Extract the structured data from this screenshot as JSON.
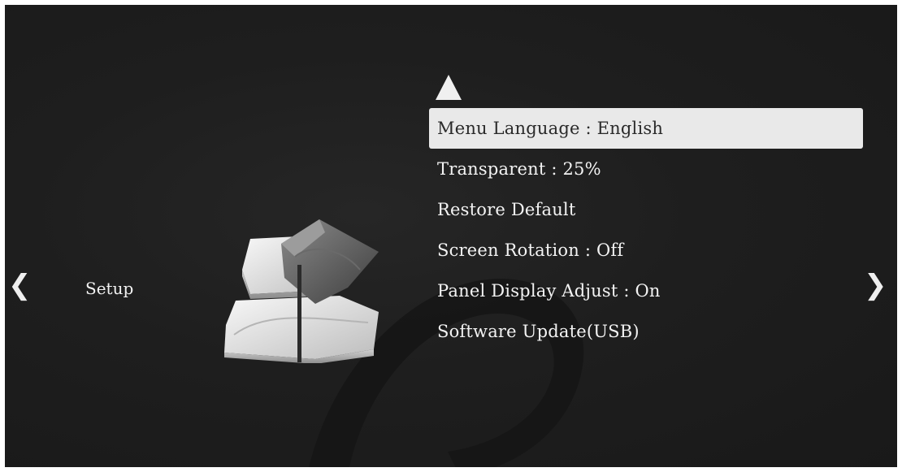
{
  "navigation": {
    "prev_arrow": "❮",
    "next_arrow": "❯"
  },
  "category": {
    "label": "Setup",
    "icon": "setup-icon"
  },
  "menu": {
    "scroll_up_icon": "triangle-up-icon",
    "selected_index": 0,
    "items": [
      {
        "label": "Menu Language : English"
      },
      {
        "label": "Transparent : 25%"
      },
      {
        "label": "Restore Default"
      },
      {
        "label": "Screen Rotation : Off"
      },
      {
        "label": "Panel Display Adjust : On"
      },
      {
        "label": "Software Update(USB)"
      }
    ]
  },
  "colors": {
    "background": "#1e1e1e",
    "text": "#f3f3f3",
    "highlight": "#e9e9e9",
    "highlight_text": "#2a2a2a"
  }
}
